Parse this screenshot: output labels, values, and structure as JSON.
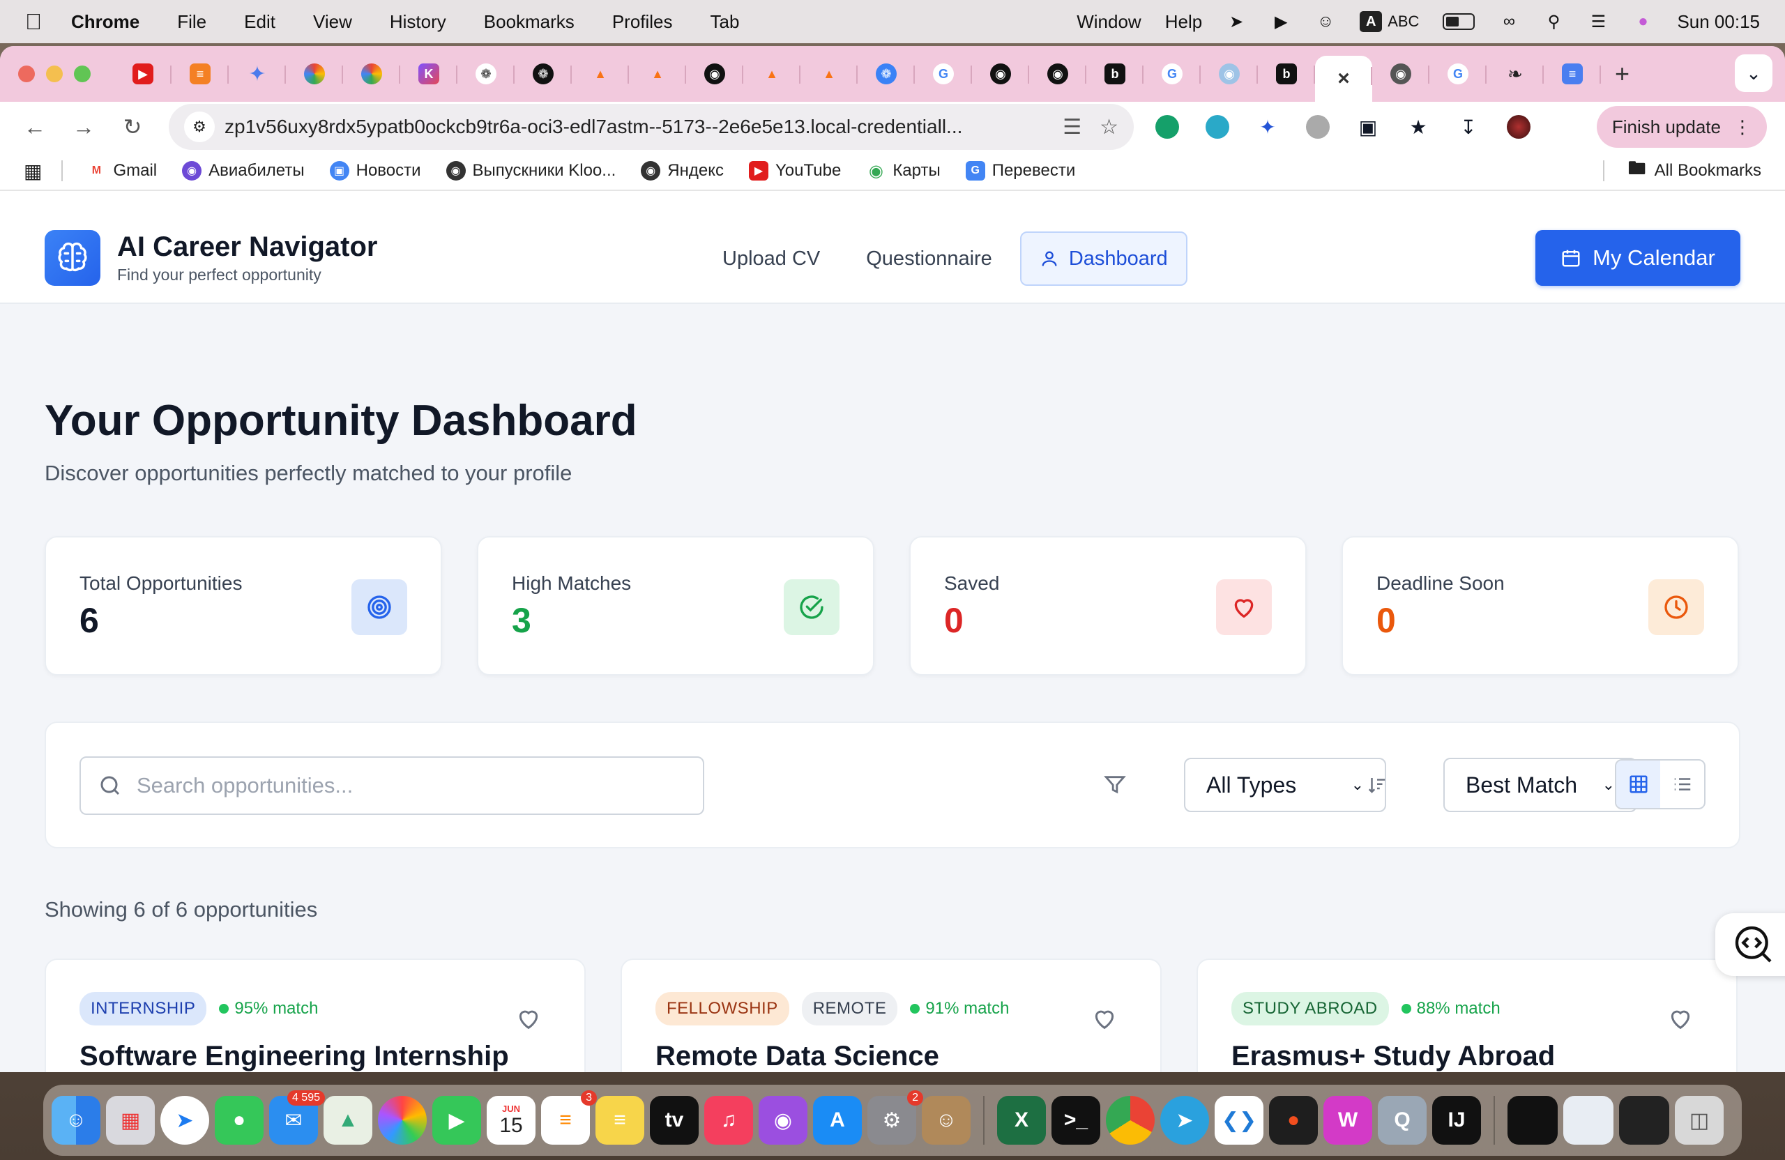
{
  "menubar": {
    "app": "Chrome",
    "items": [
      "File",
      "Edit",
      "View",
      "History",
      "Bookmarks",
      "Profiles",
      "Tab",
      "Window",
      "Help"
    ],
    "input_source": "ABC",
    "clock": "Sun  00:15"
  },
  "browser": {
    "url": "zp1v56uxy8rdx5ypatb0ockcb9tr6a-oci3-edl7astm--5173--2e6e5e13.local-credentiall...",
    "finish_update": "Finish update",
    "bookmarks": [
      "Gmail",
      "Авиабилеты",
      "Новости",
      "Выпускники Kloo...",
      "Яндекс",
      "YouTube",
      "Карты",
      "Перевести"
    ],
    "all_bookmarks": "All Bookmarks"
  },
  "app": {
    "title": "AI Career Navigator",
    "subtitle": "Find your perfect opportunity",
    "nav": [
      "Upload CV",
      "Questionnaire",
      "Dashboard"
    ],
    "calendar_button": "My Calendar"
  },
  "dashboard": {
    "heading": "Your Opportunity Dashboard",
    "subheading": "Discover opportunities perfectly matched to your profile",
    "stats": [
      {
        "label": "Total Opportunities",
        "value": "6",
        "color": "#111827",
        "icon": "target-icon",
        "icon_bg": "#dbe7fb"
      },
      {
        "label": "High Matches",
        "value": "3",
        "color": "#16a34a",
        "icon": "check-circle-icon",
        "icon_bg": "#dcf5e4"
      },
      {
        "label": "Saved",
        "value": "0",
        "color": "#dc2626",
        "icon": "heart-icon",
        "icon_bg": "#fde2e2"
      },
      {
        "label": "Deadline Soon",
        "value": "0",
        "color": "#ea580c",
        "icon": "clock-icon",
        "icon_bg": "#fdebd8"
      }
    ],
    "search_placeholder": "Search opportunities...",
    "type_filter": "All Types",
    "sort": "Best Match",
    "showing": "Showing 6 of 6 opportunities",
    "cards": [
      {
        "badges": [
          {
            "text": "INTERNSHIP",
            "bg": "#dbe7fb",
            "color": "#1e40af"
          }
        ],
        "match": "95% match",
        "title": "Software Engineering Internship"
      },
      {
        "badges": [
          {
            "text": "FELLOWSHIP",
            "bg": "#fde8d4",
            "color": "#9a3412"
          },
          {
            "text": "REMOTE",
            "bg": "#eef0f3",
            "color": "#374151"
          }
        ],
        "match": "91% match",
        "title": "Remote Data Science"
      },
      {
        "badges": [
          {
            "text": "STUDY ABROAD",
            "bg": "#dcf5e4",
            "color": "#166534"
          }
        ],
        "match": "88% match",
        "title": "Erasmus+ Study Abroad"
      }
    ]
  },
  "dock": {
    "mail_badge": "4 595",
    "reminders_badge": "3",
    "settings_badge": "2",
    "calendar_month": "JUN",
    "calendar_day": "15"
  }
}
